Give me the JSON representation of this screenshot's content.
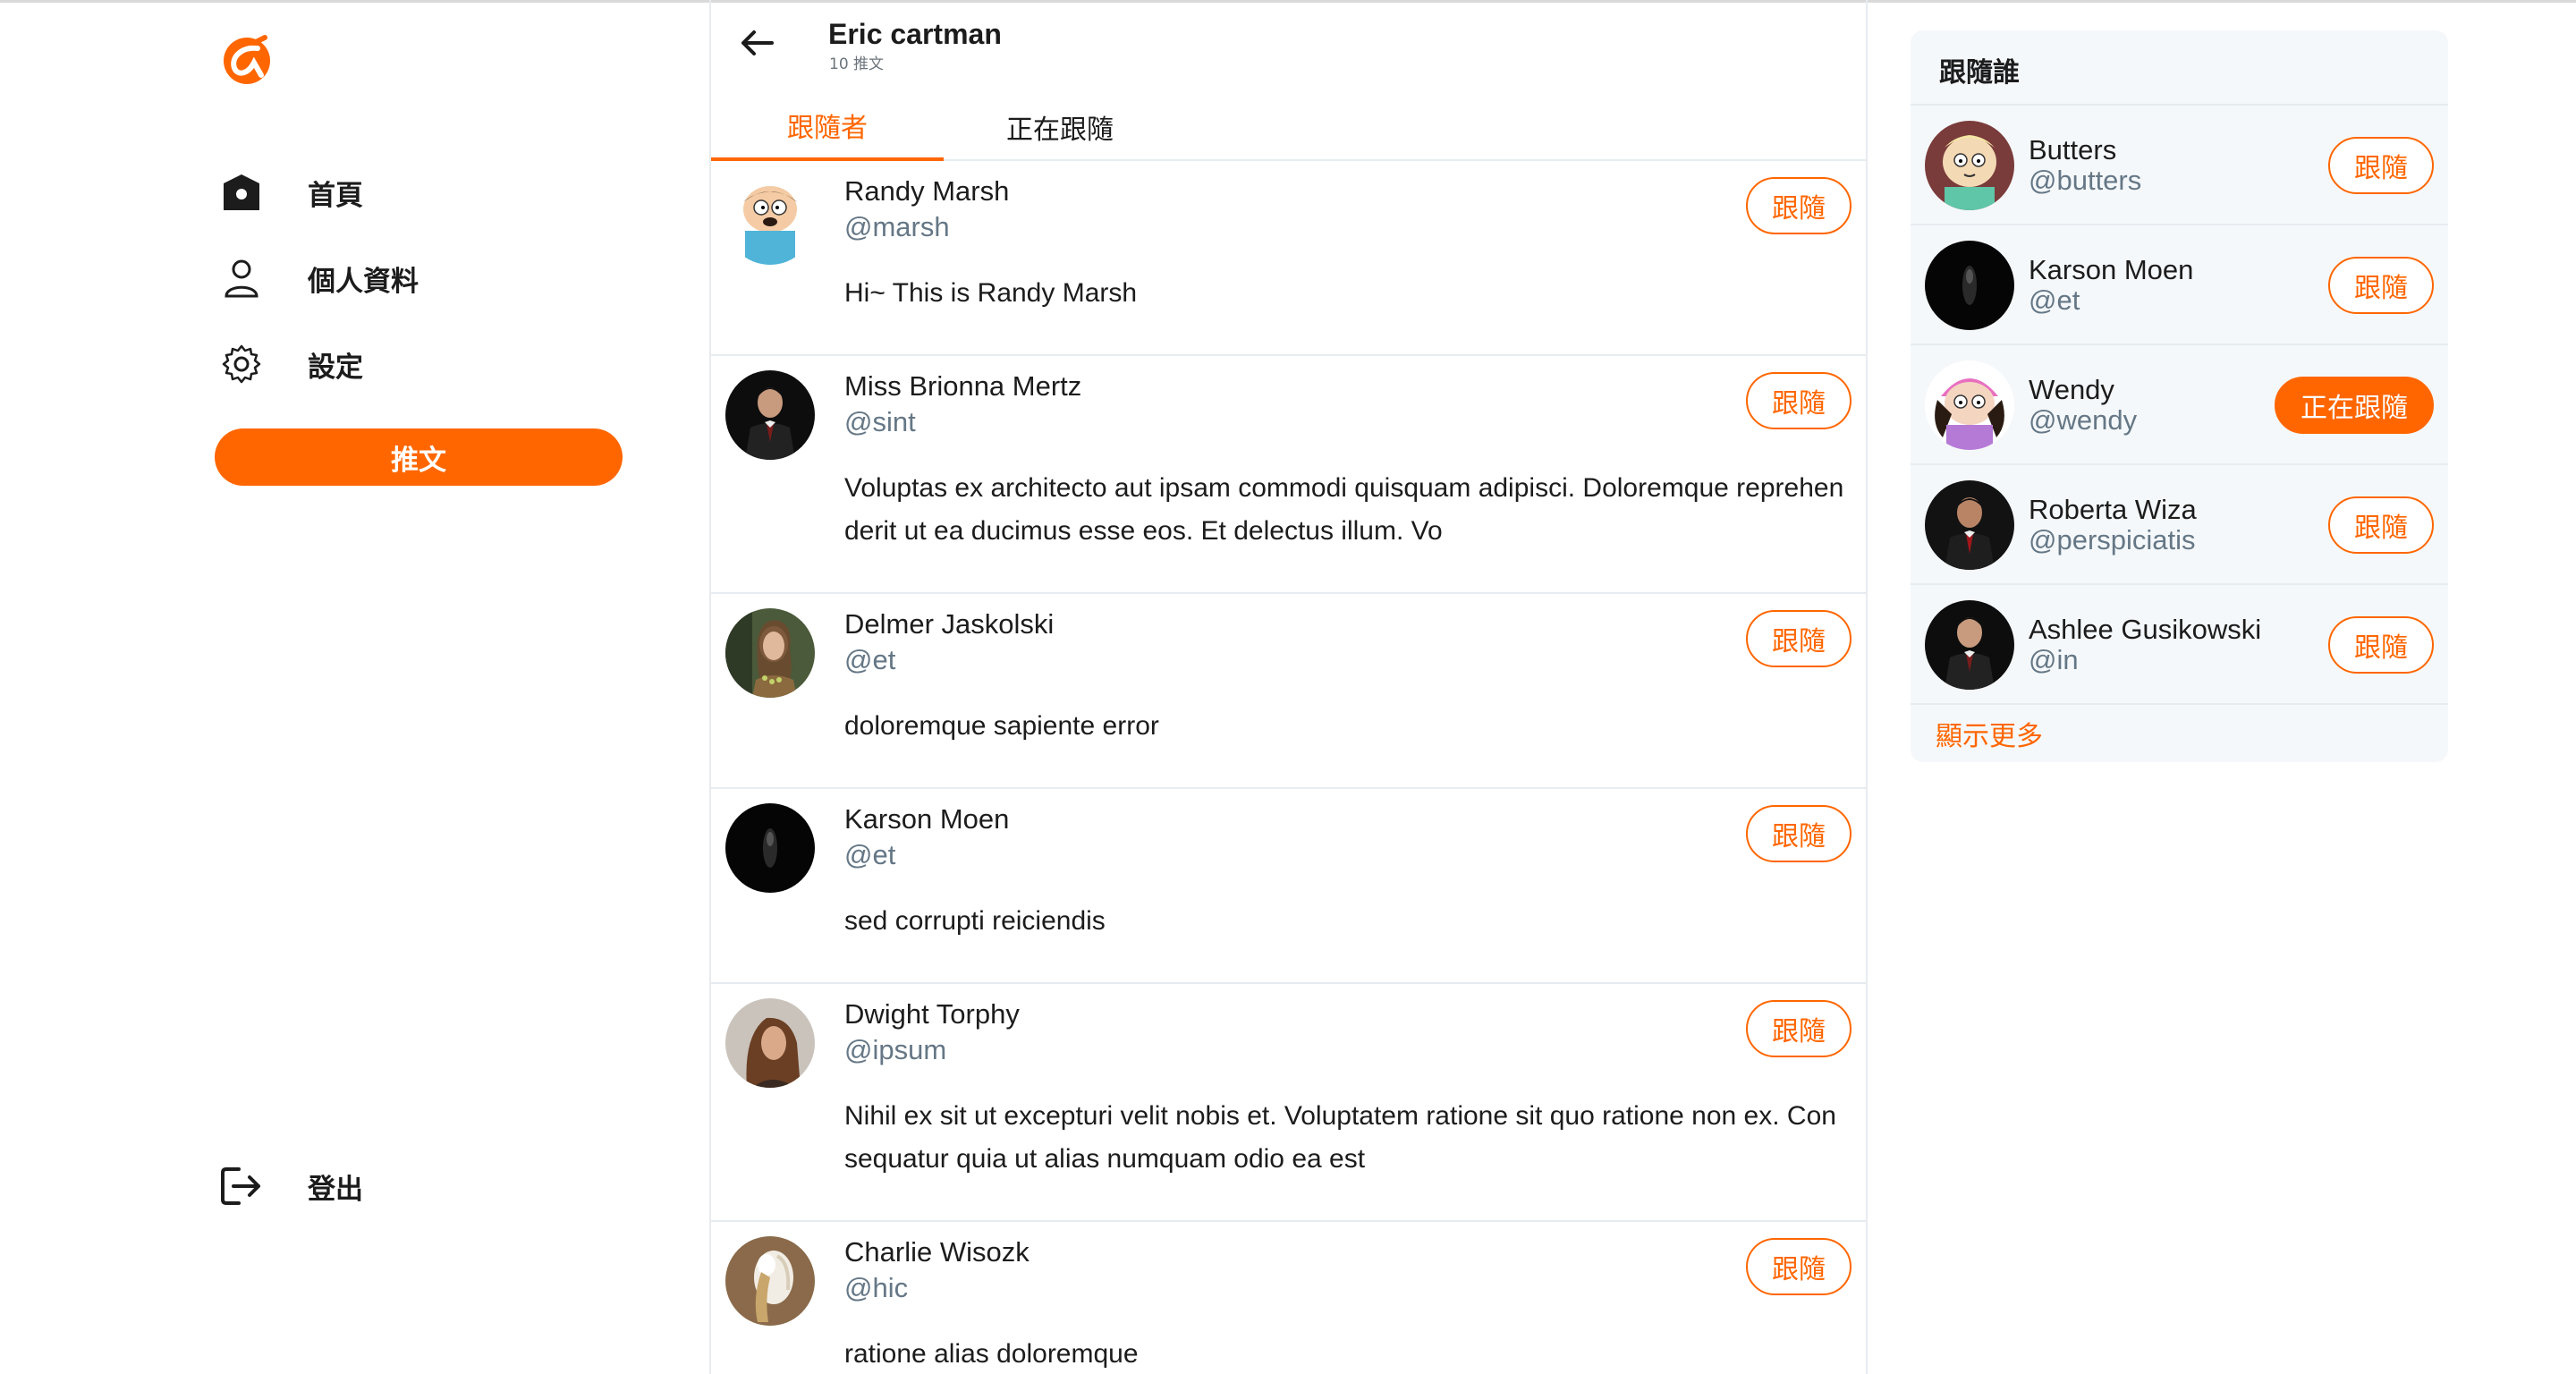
{
  "sidebar": {
    "logo_icon": "brand-logo-icon",
    "accent": "#ff6600",
    "items": [
      {
        "label": "首頁",
        "icon": "home-icon"
      },
      {
        "label": "個人資料",
        "icon": "user-icon"
      },
      {
        "label": "設定",
        "icon": "gear-icon"
      }
    ],
    "tweet_button": "推文",
    "logout": {
      "label": "登出",
      "icon": "logout-icon"
    }
  },
  "header": {
    "name": "Eric cartman",
    "tweet_count": "10 推文",
    "back_icon": "arrow-left-icon"
  },
  "tabs": [
    {
      "label": "跟隨者",
      "active": true
    },
    {
      "label": "正在跟隨",
      "active": false
    }
  ],
  "followers": [
    {
      "name": "Randy Marsh",
      "handle": "@marsh",
      "bio": "Hi~ This is Randy Marsh",
      "button": "跟隨"
    },
    {
      "name": "Miss Brionna Mertz",
      "handle": "@sint",
      "bio": "Voluptas ex architecto aut ipsam commodi quisquam adipisci. Doloremque reprehenderit ut ea ducimus esse eos. Et delectus illum. Vo",
      "button": "跟隨"
    },
    {
      "name": "Delmer Jaskolski",
      "handle": "@et",
      "bio": "doloremque sapiente error",
      "button": "跟隨"
    },
    {
      "name": "Karson Moen",
      "handle": "@et",
      "bio": "sed corrupti reiciendis",
      "button": "跟隨"
    },
    {
      "name": "Dwight Torphy",
      "handle": "@ipsum",
      "bio": "Nihil ex sit ut excepturi velit nobis et. Voluptatem ratione sit quo ratione non ex. Consequatur quia ut alias numquam odio ea est",
      "button": "跟隨"
    },
    {
      "name": "Charlie Wisozk",
      "handle": "@hic",
      "bio": "ratione alias doloremque",
      "button": "跟隨"
    }
  ],
  "who_to_follow": {
    "title": "跟隨誰",
    "users": [
      {
        "name": "Butters",
        "handle": "@butters",
        "button": "跟隨",
        "following": false
      },
      {
        "name": "Karson Moen",
        "handle": "@et",
        "button": "跟隨",
        "following": false
      },
      {
        "name": "Wendy",
        "handle": "@wendy",
        "button": "正在跟隨",
        "following": true
      },
      {
        "name": "Roberta Wiza",
        "handle": "@perspiciatis",
        "button": "跟隨",
        "following": false
      },
      {
        "name": "Ashlee Gusikowski",
        "handle": "@in",
        "button": "跟隨",
        "following": false
      }
    ],
    "show_more": "顯示更多"
  }
}
